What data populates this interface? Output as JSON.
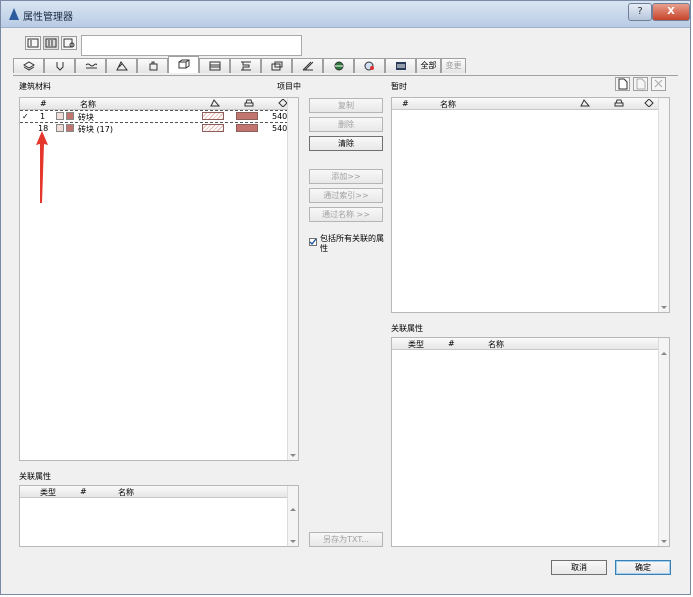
{
  "window": {
    "title": "属性管理器",
    "help_label": "?",
    "close_label": "X"
  },
  "toolbar": {
    "search_value": ""
  },
  "tabs": {
    "icons": [
      "layers-icon",
      "pen-icon",
      "line-type-icon",
      "fill-icon",
      "composite-icon",
      "building-material-icon",
      "profile-icon",
      "zone-icon",
      "markup-icon",
      "surface-icon",
      "globe-icon",
      "palette-icon",
      "list-icon"
    ],
    "all_label": "全部",
    "change_label": "变更"
  },
  "left": {
    "section_label": "建筑材料",
    "project_label": "项目中",
    "columns": {
      "num": "#",
      "name": "名称"
    },
    "rows": [
      {
        "check": "✓",
        "num": "1",
        "name": "砖块",
        "value": "540"
      },
      {
        "check": "",
        "num": "18",
        "name": "砖块 (17)",
        "value": "540"
      }
    ],
    "assoc_label": "关联属性",
    "assoc_columns": {
      "type": "类型",
      "num": "#",
      "name": "名称"
    }
  },
  "middle": {
    "copy_label": "复制",
    "delete_label": "删除",
    "clear_label": "清除",
    "add_label": "添加>>",
    "by_index_label": "通过索引>>",
    "by_name_label": "通过名称 >>",
    "include_label": "包括所有关联的属性",
    "include_checked": true,
    "saveas_label": "另存为TXT..."
  },
  "right": {
    "section_label": "暂时",
    "columns": {
      "num": "#",
      "name": "名称"
    },
    "assoc_label": "关联属性",
    "assoc_columns": {
      "type": "类型",
      "num": "#",
      "name": "名称"
    }
  },
  "footer": {
    "cancel_label": "取消",
    "ok_label": "确定"
  },
  "colors": {
    "brick": "#c0766e",
    "hatch": "#e8b4ad",
    "accent_arrow": "#e6372d",
    "window_border": "#7a8aa5"
  }
}
